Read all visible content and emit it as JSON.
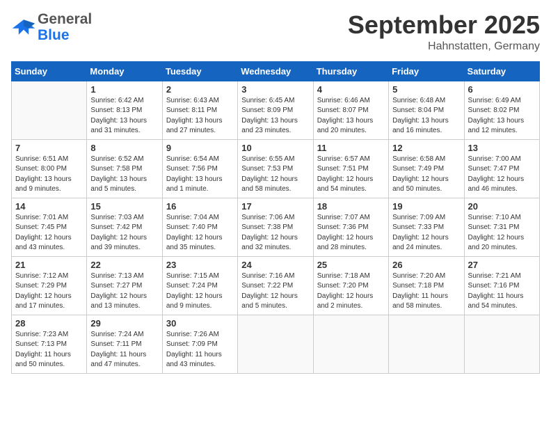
{
  "header": {
    "logo_line1": "General",
    "logo_line2": "Blue",
    "month": "September 2025",
    "location": "Hahnstatten, Germany"
  },
  "weekdays": [
    "Sunday",
    "Monday",
    "Tuesday",
    "Wednesday",
    "Thursday",
    "Friday",
    "Saturday"
  ],
  "weeks": [
    [
      {
        "day": "",
        "info": ""
      },
      {
        "day": "1",
        "info": "Sunrise: 6:42 AM\nSunset: 8:13 PM\nDaylight: 13 hours and 31 minutes."
      },
      {
        "day": "2",
        "info": "Sunrise: 6:43 AM\nSunset: 8:11 PM\nDaylight: 13 hours and 27 minutes."
      },
      {
        "day": "3",
        "info": "Sunrise: 6:45 AM\nSunset: 8:09 PM\nDaylight: 13 hours and 23 minutes."
      },
      {
        "day": "4",
        "info": "Sunrise: 6:46 AM\nSunset: 8:07 PM\nDaylight: 13 hours and 20 minutes."
      },
      {
        "day": "5",
        "info": "Sunrise: 6:48 AM\nSunset: 8:04 PM\nDaylight: 13 hours and 16 minutes."
      },
      {
        "day": "6",
        "info": "Sunrise: 6:49 AM\nSunset: 8:02 PM\nDaylight: 13 hours and 12 minutes."
      }
    ],
    [
      {
        "day": "7",
        "info": "Sunrise: 6:51 AM\nSunset: 8:00 PM\nDaylight: 13 hours and 9 minutes."
      },
      {
        "day": "8",
        "info": "Sunrise: 6:52 AM\nSunset: 7:58 PM\nDaylight: 13 hours and 5 minutes."
      },
      {
        "day": "9",
        "info": "Sunrise: 6:54 AM\nSunset: 7:56 PM\nDaylight: 13 hours and 1 minute."
      },
      {
        "day": "10",
        "info": "Sunrise: 6:55 AM\nSunset: 7:53 PM\nDaylight: 12 hours and 58 minutes."
      },
      {
        "day": "11",
        "info": "Sunrise: 6:57 AM\nSunset: 7:51 PM\nDaylight: 12 hours and 54 minutes."
      },
      {
        "day": "12",
        "info": "Sunrise: 6:58 AM\nSunset: 7:49 PM\nDaylight: 12 hours and 50 minutes."
      },
      {
        "day": "13",
        "info": "Sunrise: 7:00 AM\nSunset: 7:47 PM\nDaylight: 12 hours and 46 minutes."
      }
    ],
    [
      {
        "day": "14",
        "info": "Sunrise: 7:01 AM\nSunset: 7:45 PM\nDaylight: 12 hours and 43 minutes."
      },
      {
        "day": "15",
        "info": "Sunrise: 7:03 AM\nSunset: 7:42 PM\nDaylight: 12 hours and 39 minutes."
      },
      {
        "day": "16",
        "info": "Sunrise: 7:04 AM\nSunset: 7:40 PM\nDaylight: 12 hours and 35 minutes."
      },
      {
        "day": "17",
        "info": "Sunrise: 7:06 AM\nSunset: 7:38 PM\nDaylight: 12 hours and 32 minutes."
      },
      {
        "day": "18",
        "info": "Sunrise: 7:07 AM\nSunset: 7:36 PM\nDaylight: 12 hours and 28 minutes."
      },
      {
        "day": "19",
        "info": "Sunrise: 7:09 AM\nSunset: 7:33 PM\nDaylight: 12 hours and 24 minutes."
      },
      {
        "day": "20",
        "info": "Sunrise: 7:10 AM\nSunset: 7:31 PM\nDaylight: 12 hours and 20 minutes."
      }
    ],
    [
      {
        "day": "21",
        "info": "Sunrise: 7:12 AM\nSunset: 7:29 PM\nDaylight: 12 hours and 17 minutes."
      },
      {
        "day": "22",
        "info": "Sunrise: 7:13 AM\nSunset: 7:27 PM\nDaylight: 12 hours and 13 minutes."
      },
      {
        "day": "23",
        "info": "Sunrise: 7:15 AM\nSunset: 7:24 PM\nDaylight: 12 hours and 9 minutes."
      },
      {
        "day": "24",
        "info": "Sunrise: 7:16 AM\nSunset: 7:22 PM\nDaylight: 12 hours and 5 minutes."
      },
      {
        "day": "25",
        "info": "Sunrise: 7:18 AM\nSunset: 7:20 PM\nDaylight: 12 hours and 2 minutes."
      },
      {
        "day": "26",
        "info": "Sunrise: 7:20 AM\nSunset: 7:18 PM\nDaylight: 11 hours and 58 minutes."
      },
      {
        "day": "27",
        "info": "Sunrise: 7:21 AM\nSunset: 7:16 PM\nDaylight: 11 hours and 54 minutes."
      }
    ],
    [
      {
        "day": "28",
        "info": "Sunrise: 7:23 AM\nSunset: 7:13 PM\nDaylight: 11 hours and 50 minutes."
      },
      {
        "day": "29",
        "info": "Sunrise: 7:24 AM\nSunset: 7:11 PM\nDaylight: 11 hours and 47 minutes."
      },
      {
        "day": "30",
        "info": "Sunrise: 7:26 AM\nSunset: 7:09 PM\nDaylight: 11 hours and 43 minutes."
      },
      {
        "day": "",
        "info": ""
      },
      {
        "day": "",
        "info": ""
      },
      {
        "day": "",
        "info": ""
      },
      {
        "day": "",
        "info": ""
      }
    ]
  ]
}
